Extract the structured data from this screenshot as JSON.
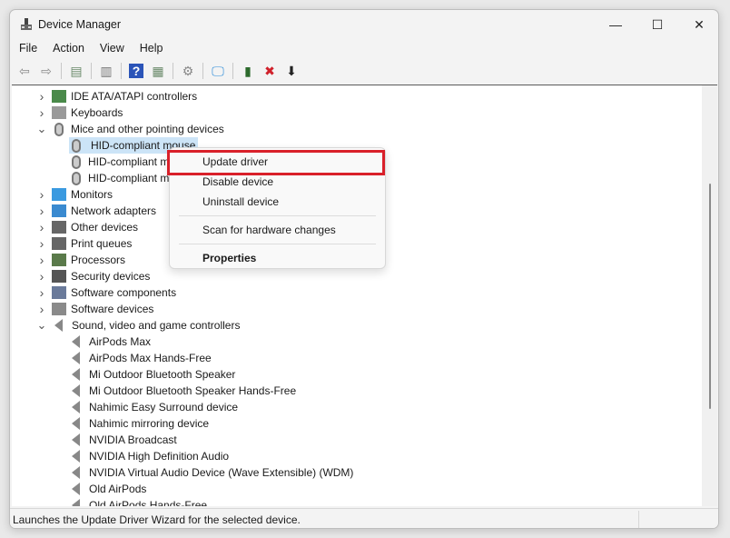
{
  "window": {
    "title": "Device Manager",
    "minimize": "—",
    "maximize": "☐",
    "close": "✕"
  },
  "menu": [
    "File",
    "Action",
    "View",
    "Help"
  ],
  "toolbar": [
    {
      "icon": "back-icon",
      "g": "⇦",
      "c": "#8a8a8a"
    },
    {
      "icon": "forward-icon",
      "g": "⇨",
      "c": "#8a8a8a"
    },
    {
      "sep": true
    },
    {
      "icon": "show-hide-console-tree-icon",
      "g": "▤",
      "c": "#6a8a6a"
    },
    {
      "sep": true
    },
    {
      "icon": "properties-icon",
      "g": "▥",
      "c": "#777"
    },
    {
      "sep": true
    },
    {
      "icon": "help-icon",
      "g": "?",
      "c": "#fff",
      "bg": "#2b54b8"
    },
    {
      "icon": "action-pane-icon",
      "g": "▦",
      "c": "#6a8a6a"
    },
    {
      "sep": true
    },
    {
      "icon": "update-driver-icon",
      "g": "⚙",
      "c": "#888"
    },
    {
      "sep": true
    },
    {
      "icon": "scan-hardware-icon",
      "g": "🖵",
      "c": "#2a8ad8"
    },
    {
      "sep": true
    },
    {
      "icon": "enable-device-icon",
      "g": "▮",
      "c": "#2c6a2c"
    },
    {
      "icon": "uninstall-icon",
      "g": "✖",
      "c": "#d0202a"
    },
    {
      "icon": "disable-device-icon",
      "g": "⬇",
      "c": "#222"
    }
  ],
  "tree": [
    {
      "label": "IDE ATA/ATAPI controllers",
      "level": 0,
      "state": "collapsed",
      "icon": "ide-controller-icon",
      "color": "#4a8a4a"
    },
    {
      "label": "Keyboards",
      "level": 0,
      "state": "collapsed",
      "icon": "keyboard-icon",
      "color": "#9a9a9a"
    },
    {
      "label": "Mice and other pointing devices",
      "level": 0,
      "state": "expanded",
      "icon": "mouse-icon",
      "color": "#777"
    },
    {
      "label": "HID-compliant mouse",
      "level": 1,
      "icon": "mouse-icon",
      "color": "#777",
      "selected": true
    },
    {
      "label": "HID-compliant mouse",
      "level": 1,
      "icon": "mouse-icon",
      "color": "#777"
    },
    {
      "label": "HID-compliant mouse",
      "level": 1,
      "icon": "mouse-icon",
      "color": "#777"
    },
    {
      "label": "Monitors",
      "level": 0,
      "state": "collapsed",
      "icon": "monitor-icon",
      "color": "#3a9ae0"
    },
    {
      "label": "Network adapters",
      "level": 0,
      "state": "collapsed",
      "icon": "network-icon",
      "color": "#3a8ad0"
    },
    {
      "label": "Other devices",
      "level": 0,
      "state": "collapsed",
      "icon": "unknown-device-icon",
      "color": "#666"
    },
    {
      "label": "Print queues",
      "level": 0,
      "state": "collapsed",
      "icon": "printer-icon",
      "color": "#666"
    },
    {
      "label": "Processors",
      "level": 0,
      "state": "collapsed",
      "icon": "processor-icon",
      "color": "#5a7a4a"
    },
    {
      "label": "Security devices",
      "level": 0,
      "state": "collapsed",
      "icon": "security-device-icon",
      "color": "#555"
    },
    {
      "label": "Software components",
      "level": 0,
      "state": "collapsed",
      "icon": "software-component-icon",
      "color": "#6a7a9a"
    },
    {
      "label": "Software devices",
      "level": 0,
      "state": "collapsed",
      "icon": "software-device-icon",
      "color": "#8a8a8a"
    },
    {
      "label": "Sound, video and game controllers",
      "level": 0,
      "state": "expanded",
      "icon": "speaker-icon",
      "color": "#888"
    },
    {
      "label": "AirPods Max",
      "level": 1,
      "icon": "speaker-icon",
      "color": "#888"
    },
    {
      "label": "AirPods Max Hands-Free",
      "level": 1,
      "icon": "speaker-icon",
      "color": "#888"
    },
    {
      "label": "Mi Outdoor Bluetooth Speaker",
      "level": 1,
      "icon": "speaker-icon",
      "color": "#888"
    },
    {
      "label": "Mi Outdoor Bluetooth Speaker Hands-Free",
      "level": 1,
      "icon": "speaker-icon",
      "color": "#888"
    },
    {
      "label": "Nahimic Easy Surround device",
      "level": 1,
      "icon": "speaker-icon",
      "color": "#888"
    },
    {
      "label": "Nahimic mirroring device",
      "level": 1,
      "icon": "speaker-icon",
      "color": "#888"
    },
    {
      "label": "NVIDIA Broadcast",
      "level": 1,
      "icon": "speaker-icon",
      "color": "#888"
    },
    {
      "label": "NVIDIA High Definition Audio",
      "level": 1,
      "icon": "speaker-icon",
      "color": "#888"
    },
    {
      "label": "NVIDIA Virtual Audio Device (Wave Extensible) (WDM)",
      "level": 1,
      "icon": "speaker-icon",
      "color": "#888"
    },
    {
      "label": "Old AirPods",
      "level": 1,
      "icon": "speaker-icon",
      "color": "#888"
    },
    {
      "label": "Old AirPods Hands-Free",
      "level": 1,
      "icon": "speaker-icon",
      "color": "#888"
    }
  ],
  "context_menu": {
    "items": [
      "Update driver",
      "Disable device",
      "Uninstall device",
      "Scan for hardware changes",
      "Properties"
    ],
    "highlight_color": "#d9202a"
  },
  "status": "Launches the Update Driver Wizard for the selected device."
}
